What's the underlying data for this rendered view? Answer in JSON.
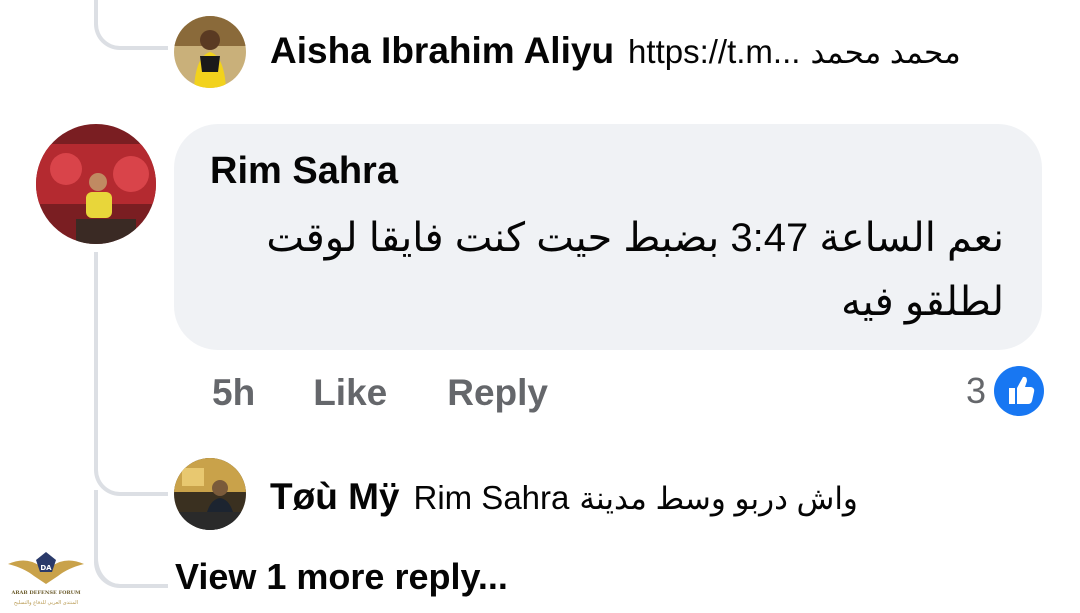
{
  "reply_top": {
    "author": "Aisha Ibrahim Aliyu",
    "mention": "https://t.m...",
    "text": "محمد محمد"
  },
  "comment": {
    "author": "Rim Sahra",
    "text": "نعم الساعة 3:47 بضبط حيت كنت فايقا لوقت لطلقو فيه",
    "time": "5h",
    "like_label": "Like",
    "reply_label": "Reply",
    "reaction_count": "3",
    "reaction_icon": "like-thumb-icon"
  },
  "reply_bottom": {
    "author": "Tøù Mÿ",
    "mention": "Rim Sahra",
    "text": "واش دربو وسط مدينة"
  },
  "view_more_label": "View 1 more reply...",
  "watermark": {
    "icon": "eagle-logo",
    "initials": "DA",
    "line1": "ARAB DEFENSE FORUM",
    "line2": "المنتدى العربي للدفاع والتسليح"
  },
  "colors": {
    "bubble": "#f0f2f5",
    "muted_text": "#65676b",
    "like_blue": "#1877f2",
    "thread_line": "#dcdfe4"
  }
}
